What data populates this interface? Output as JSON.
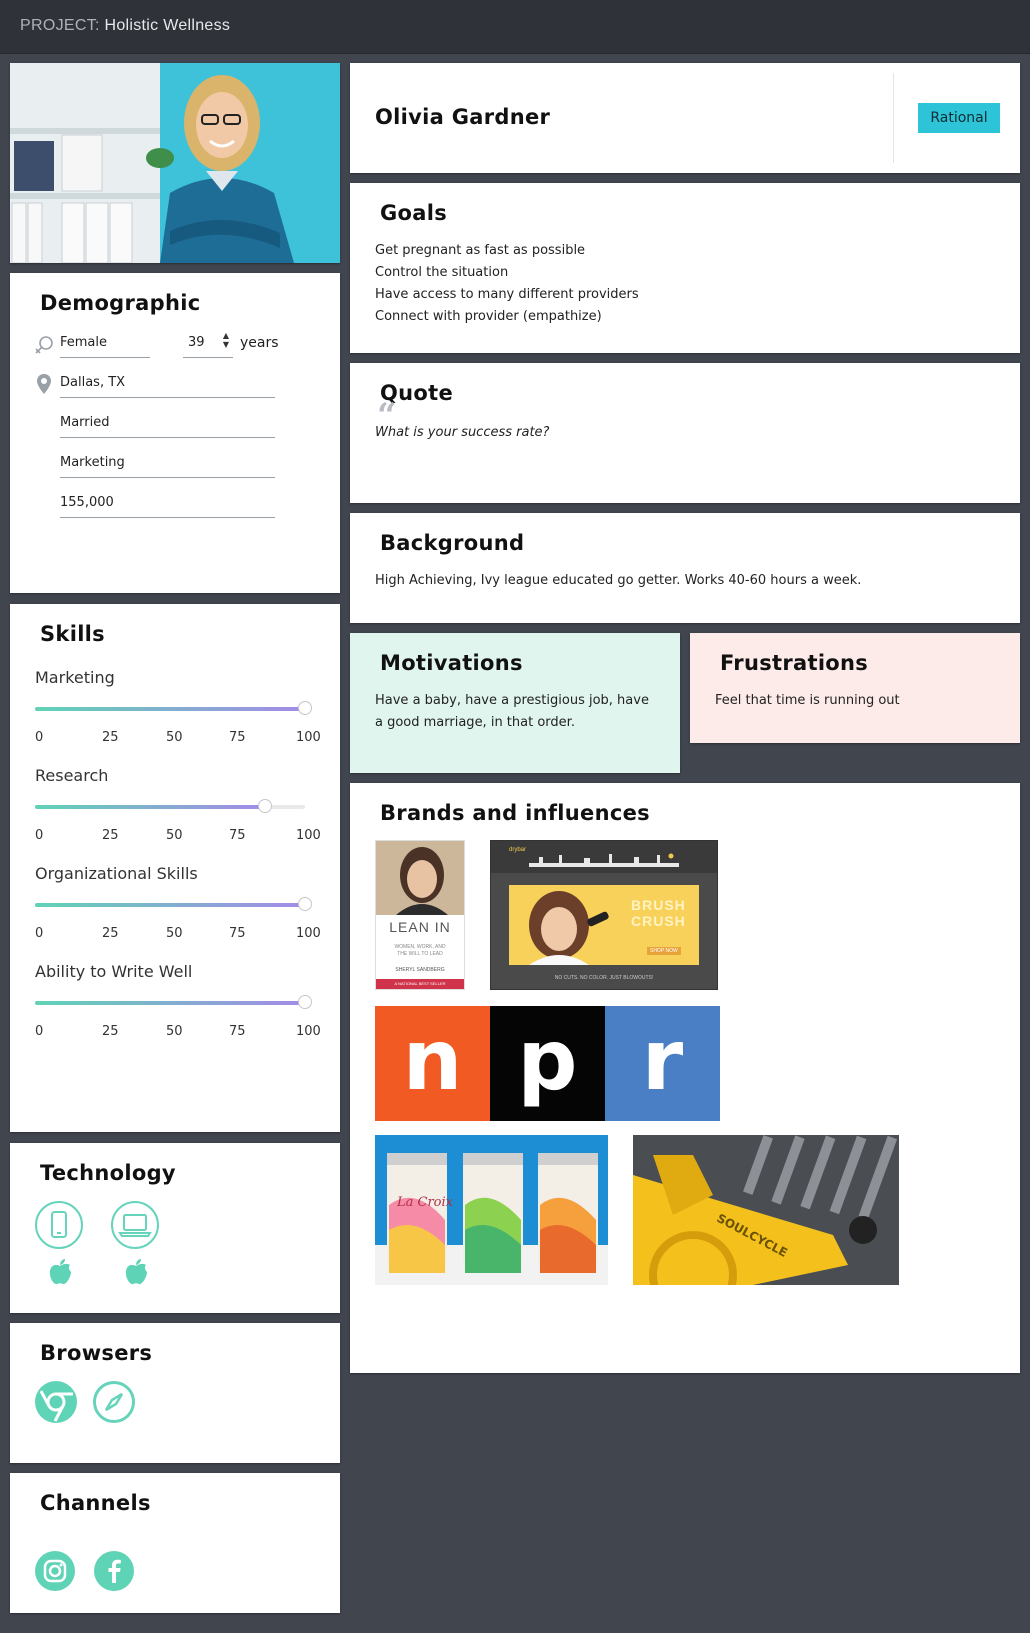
{
  "project": {
    "prefix": "PROJECT:",
    "name": "Holistic Wellness"
  },
  "persona": {
    "name": "Olivia Gardner",
    "type_badge": "Rational"
  },
  "demographic": {
    "title": "Demographic",
    "gender": "Female",
    "age": "39",
    "age_unit": "years",
    "location": "Dallas, TX",
    "marital": "Married",
    "occupation": "Marketing",
    "income": "155,000"
  },
  "skills": {
    "title": "Skills",
    "ticks": [
      "0",
      "25",
      "50",
      "75",
      "100"
    ],
    "items": [
      {
        "label": "Marketing",
        "value": 100
      },
      {
        "label": "Research",
        "value": 85
      },
      {
        "label": "Organizational Skills",
        "value": 100
      },
      {
        "label": "Ability to Write Well",
        "value": 100
      }
    ]
  },
  "technology": {
    "title": "Technology",
    "devices": [
      "mobile-phone-icon",
      "laptop-icon"
    ],
    "os": [
      "apple-icon",
      "apple-icon"
    ]
  },
  "browsers": {
    "title": "Browsers",
    "items": [
      "chrome-icon",
      "safari-icon"
    ]
  },
  "channels": {
    "title": "Channels",
    "items": [
      "instagram-icon",
      "facebook-icon"
    ]
  },
  "goals": {
    "title": "Goals",
    "items": [
      "Get pregnant as fast as possible",
      "Control the situation",
      "Have access to many different providers",
      "Connect with provider (empathize)"
    ]
  },
  "quote": {
    "title": "Quote",
    "text": "What is your success rate?"
  },
  "background": {
    "title": "Background",
    "text": "High Achieving, Ivy league educated go getter. Works 40-60 hours a week."
  },
  "motivations": {
    "title": "Motivations",
    "line1": "Have a baby, have a prestigious job, have",
    "line2": "a good marriage, in that order."
  },
  "frustrations": {
    "title": "Frustrations",
    "text": "Feel that time is running out"
  },
  "brands": {
    "title": "Brands and influences",
    "lean_in": {
      "title": "LEAN IN",
      "sub1": "WOMEN, WORK, AND",
      "sub2": "THE WILL TO LEAD",
      "author": "SHERYL SANDBERG",
      "banner": "A NATIONAL BEST SELLER"
    },
    "drybar": {
      "logo": "drybar",
      "headline1": "BRUSH",
      "headline2": "CRUSH",
      "button": "SHOP NOW",
      "footer": "NO CUTS. NO COLOR. JUST BLOWOUTS!"
    },
    "npr": [
      "n",
      "p",
      "r"
    ],
    "lacroix": "La Croix",
    "soulcycle": "SOULCYCLE"
  },
  "colors": {
    "accent": "#5fd3b6",
    "badge": "#2ec4d8",
    "motivations_bg": "#e0f5ee",
    "frustrations_bg": "#fdebe9",
    "npr_orange": "#f15a22",
    "npr_black": "#000000",
    "npr_blue": "#4a7fc6"
  }
}
